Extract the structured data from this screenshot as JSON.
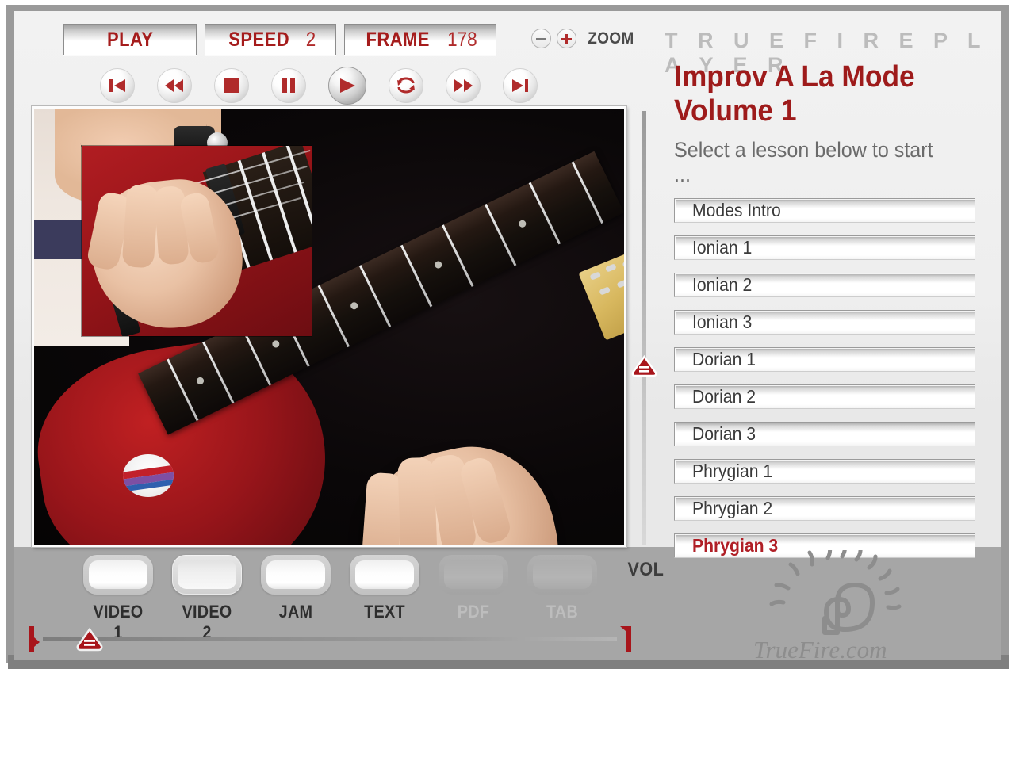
{
  "brand": {
    "wordmark": "T R U E F I R E   P L A Y E R",
    "logo_text": "TrueFire.com"
  },
  "toolbar": {
    "play_label": "PLAY",
    "speed_label": "SPEED",
    "speed_value": "2",
    "frame_label": "FRAME",
    "frame_value": "178",
    "zoom_label": "ZOOM",
    "zoom_out_icon": "minus-circle-icon",
    "zoom_in_icon": "plus-circle-icon"
  },
  "transport": [
    {
      "name": "previous-track",
      "icon": "skip-back-icon"
    },
    {
      "name": "rewind",
      "icon": "rewind-icon"
    },
    {
      "name": "stop",
      "icon": "stop-icon"
    },
    {
      "name": "pause",
      "icon": "pause-icon"
    },
    {
      "name": "play",
      "icon": "play-icon",
      "active": true
    },
    {
      "name": "loop",
      "icon": "loop-icon"
    },
    {
      "name": "fast-forward",
      "icon": "fast-forward-icon"
    },
    {
      "name": "next-track",
      "icon": "skip-forward-icon"
    }
  ],
  "sidebar": {
    "title": "Improv A La Mode\nVolume 1",
    "subtitle": "Select a lesson below to start ...",
    "lessons": [
      {
        "label": "Modes Intro",
        "selected": false
      },
      {
        "label": "Ionian 1",
        "selected": false
      },
      {
        "label": "Ionian 2",
        "selected": false
      },
      {
        "label": "Ionian 3",
        "selected": false
      },
      {
        "label": "Dorian 1",
        "selected": false
      },
      {
        "label": "Dorian 2",
        "selected": false
      },
      {
        "label": "Dorian 3",
        "selected": false
      },
      {
        "label": "Phrygian 1",
        "selected": false
      },
      {
        "label": "Phrygian 2",
        "selected": false
      },
      {
        "label": "Phrygian 3",
        "selected": true
      }
    ]
  },
  "volume": {
    "label": "VOL",
    "thumb_icon": "slider-thumb-icon"
  },
  "tabs": [
    {
      "label": "VIDEO 1",
      "state": "enabled"
    },
    {
      "label": "VIDEO 2",
      "state": "selected"
    },
    {
      "label": "JAM",
      "state": "enabled"
    },
    {
      "label": "TEXT",
      "state": "enabled"
    },
    {
      "label": "PDF",
      "state": "disabled"
    },
    {
      "label": "TAB",
      "state": "disabled"
    }
  ],
  "scrubber": {
    "in_marker_icon": "loop-in-marker-icon",
    "out_marker_icon": "loop-out-marker-icon",
    "playhead_icon": "playhead-thumb-icon"
  },
  "colors": {
    "accent_red": "#b02b2b",
    "title_red": "#9e1b1b",
    "panel_gray": "#a6a6a6",
    "frame_gray": "#9a9a9a"
  }
}
